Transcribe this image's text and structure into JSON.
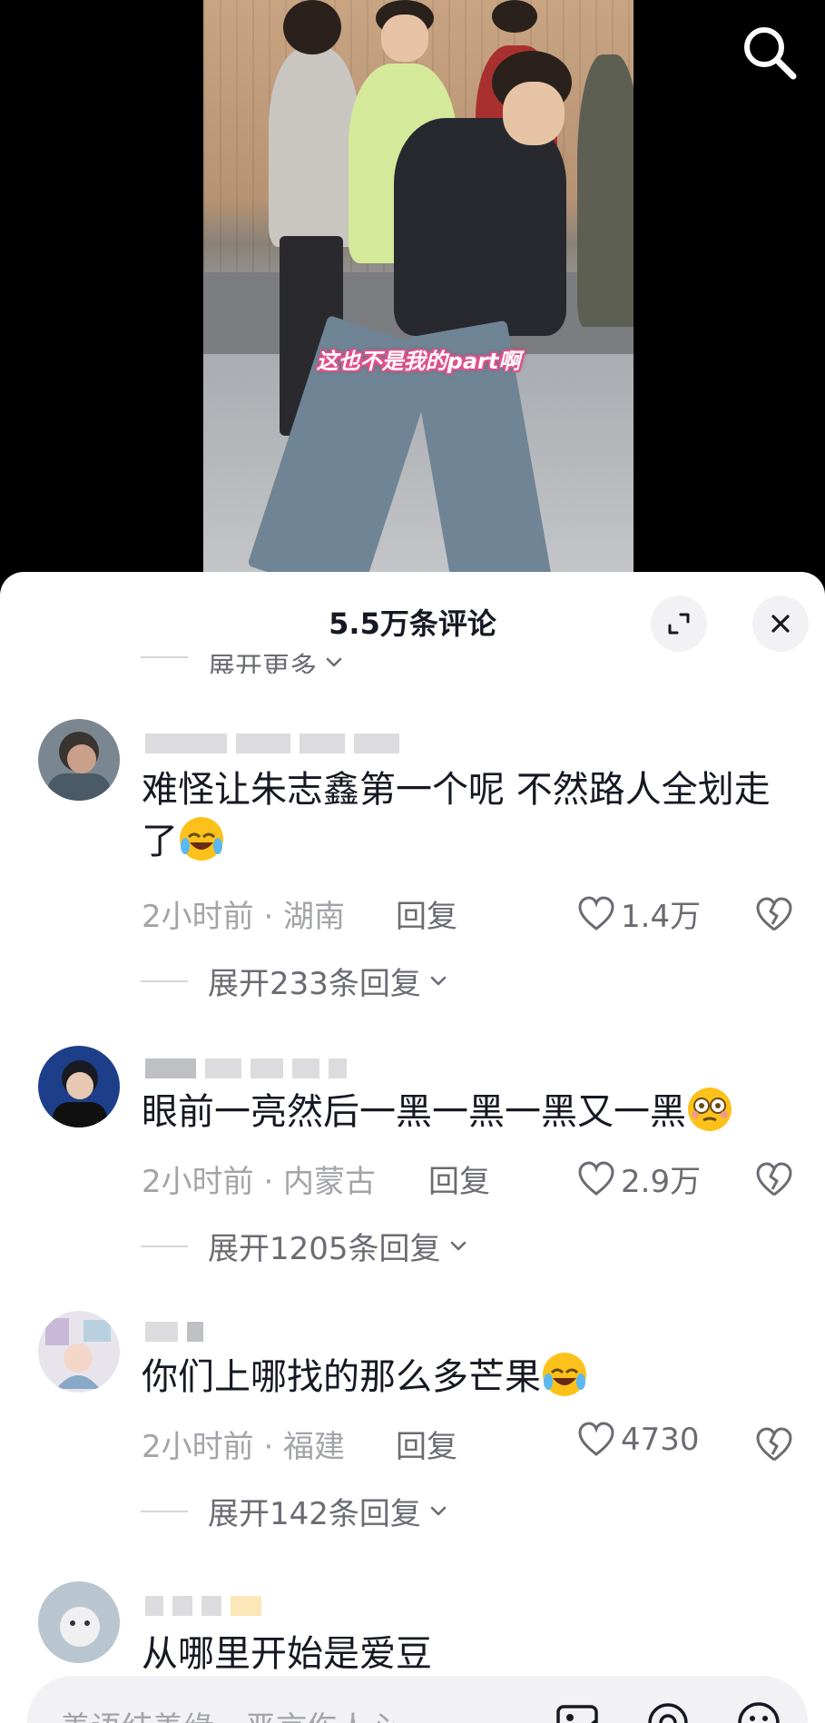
{
  "video": {
    "caption": "这也不是我的part啊"
  },
  "comments_panel": {
    "title": "5.5万条评论",
    "top_partial_expand": "展开更多"
  },
  "comments": [
    {
      "text": "难怪让朱志鑫第一个呢 不然路人全划走了",
      "emoji": "laugh-cry-emoji",
      "time_location": "2小时前 · 湖南",
      "reply_label": "回复",
      "likes": "1.4万",
      "expand_label": "展开233条回复"
    },
    {
      "text": "眼前一亮然后一黑一黑一黑又一黑",
      "emoji": "dizzy-face-emoji",
      "time_location": "2小时前 · 内蒙古",
      "reply_label": "回复",
      "likes": "2.9万",
      "expand_label": "展开1205条回复"
    },
    {
      "text": "你们上哪找的那么多芒果",
      "emoji": "laugh-cry-emoji",
      "time_location": "2小时前 · 福建",
      "reply_label": "回复",
      "likes": "4730",
      "expand_label": "展开142条回复"
    },
    {
      "text": "从哪里开始是爱豆"
    }
  ],
  "input_bar": {
    "placeholder": "善语结善缘，恶言伤人心"
  },
  "colors": {
    "caption_outline": "#e0508a",
    "muted_text": "#a3a4a9",
    "secondary_text": "#6b6c73",
    "primary_text": "#161823"
  }
}
